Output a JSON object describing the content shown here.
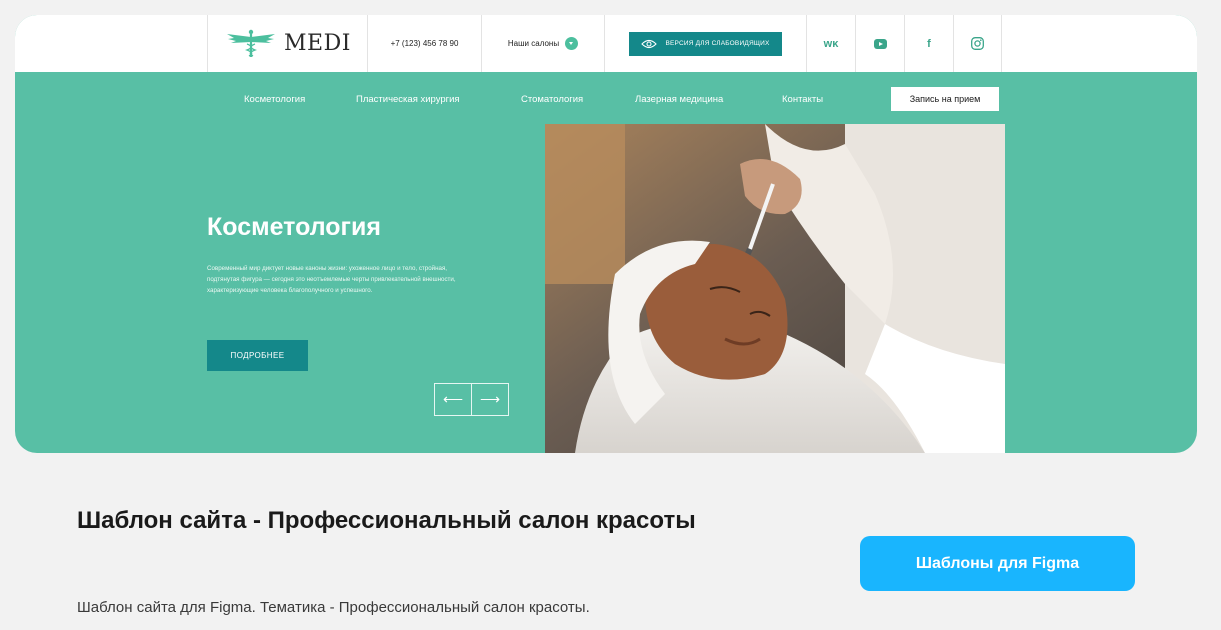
{
  "header": {
    "logo_text": "MEDI",
    "phone": "+7 (123) 456 78 90",
    "salons_label": "Наши салоны",
    "vision_label": "ВЕРСИЯ ДЛЯ СЛАБОВИДЯЩИХ",
    "social": [
      {
        "name": "vk-icon",
        "glyph": "ᴡᴋ"
      },
      {
        "name": "youtube-icon",
        "glyph": "▶"
      },
      {
        "name": "facebook-icon",
        "glyph": "f"
      },
      {
        "name": "instagram-icon",
        "glyph": "◎"
      }
    ]
  },
  "nav": {
    "items": [
      "Косметология",
      "Пластическая хирургия",
      "Стоматология",
      "Лазерная медицина",
      "Контакты"
    ],
    "book_label": "Запись на прием"
  },
  "hero": {
    "title": "Косметология",
    "text": "Современный мир диктует новые каноны жизни: ухоженное лицо и тело, стройная, подтянутая фигура — сегодня это неотъемлемые черты привлекательной внешности, характеризующие человека благополучного и успешного.",
    "more_label": "ПОДРОБНЕЕ",
    "prev_glyph": "⟵",
    "next_glyph": "⟶"
  },
  "page": {
    "title": "Шаблон сайта - Профессиональный салон красоты",
    "description": "Шаблон сайта для Figma. Тематика - Профессиональный салон красоты.",
    "figma_button": "Шаблоны для Figma"
  },
  "colors": {
    "teal": "#58bfa5",
    "dark_teal": "#14888a",
    "figma_blue": "#19b5fe"
  }
}
